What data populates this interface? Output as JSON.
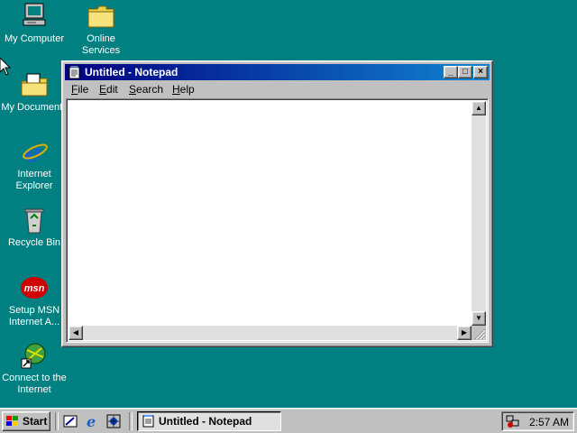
{
  "desktop": {
    "icons": [
      {
        "label1": "My Computer",
        "label2": ""
      },
      {
        "label1": "Online",
        "label2": "Services"
      },
      {
        "label1": "My Documents",
        "label2": ""
      },
      {
        "label1": "Internet",
        "label2": "Explorer"
      },
      {
        "label1": "Recycle Bin",
        "label2": ""
      },
      {
        "label1": "Setup MSN",
        "label2": "Internet A..."
      },
      {
        "label1": "Connect to the",
        "label2": "Internet"
      }
    ],
    "msn_text": "msn"
  },
  "window": {
    "title": "Untitled - Notepad",
    "minimize": "_",
    "maximize": "□",
    "close": "×",
    "menu": [
      {
        "accel": "F",
        "rest": "ile"
      },
      {
        "accel": "E",
        "rest": "dit"
      },
      {
        "accel": "S",
        "rest": "earch"
      },
      {
        "accel": "H",
        "rest": "elp"
      }
    ],
    "content": ""
  },
  "taskbar": {
    "start_label": "Start",
    "task_label": "Untitled - Notepad",
    "clock": "2:57 AM"
  },
  "colors": {
    "desktop": "#008080",
    "titlebar": "#000080",
    "chrome": "#c0c0c0"
  }
}
